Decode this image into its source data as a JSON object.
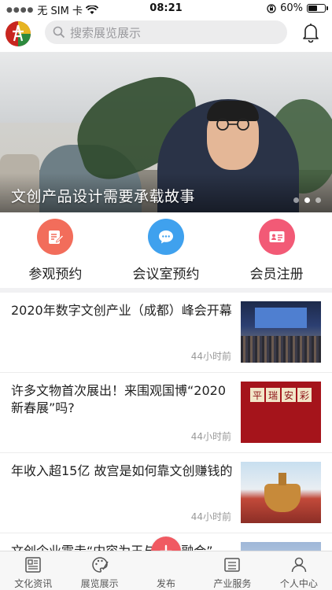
{
  "status_bar": {
    "carrier": "无 SIM 卡",
    "time": "08:21",
    "battery": "60%",
    "battery_level": 0.6
  },
  "header": {
    "search_placeholder": "搜索展览展示",
    "icons": [
      "app-logo",
      "search-icon",
      "bell-icon"
    ]
  },
  "banner": {
    "title": "文创产品设计需要承载故事",
    "slide_count": 3,
    "active_slide": 2
  },
  "quick_actions": [
    {
      "label": "参观预约",
      "icon": "document-edit-icon",
      "color": "#f26d5b"
    },
    {
      "label": "会议室预约",
      "icon": "chat-bubble-icon",
      "color": "#3fa1ee"
    },
    {
      "label": "会员注册",
      "icon": "id-card-icon",
      "color": "#f25a76"
    }
  ],
  "news": [
    {
      "title": "2020年数字文创产业（成都）峰会开幕",
      "time": "44小时前"
    },
    {
      "title": "许多文物首次展出！来围观国博“2020新春展”吗?",
      "time": "44小时前",
      "thumb_text": [
        "平",
        "瑞",
        "安",
        "彩"
      ]
    },
    {
      "title": "年收入超15亿 故宫是如何靠文创赚钱的",
      "time": "44小时前"
    },
    {
      "title": "文创企业需走“内容为王与跨界融合”",
      "time": ""
    }
  ],
  "tabbar": [
    {
      "label": "文化资讯",
      "icon": "newspaper-icon"
    },
    {
      "label": "展览展示",
      "icon": "palette-icon"
    },
    {
      "label": "发布",
      "icon": "plus-icon"
    },
    {
      "label": "产业服务",
      "icon": "service-board-icon"
    },
    {
      "label": "个人中心",
      "icon": "user-icon"
    }
  ],
  "colors": {
    "fab": "#f05a62",
    "search_bg": "#ececed",
    "separator": "#f1f1f3"
  }
}
